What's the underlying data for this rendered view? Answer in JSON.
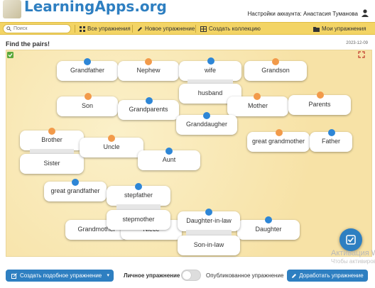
{
  "header": {
    "logo_text": "LearningApps.org",
    "account_text": "Настройки аккаунта: Анастасия Туманова"
  },
  "nav": {
    "search_placeholder": "Поиск",
    "all_exercises": "Все упражнения",
    "new_exercise": "Новое упражнение",
    "create_collection": "Создать коллекцию",
    "my_exercises": "Мои упражнения"
  },
  "exercise": {
    "title": "Find the pairs!",
    "date": "2023-12-09"
  },
  "cards": {
    "grandfather": "Grandfather",
    "nephew": "Nephew",
    "wife": "wife",
    "husband": "husband",
    "grandson": "Grandson",
    "son": "Son",
    "grandparents": "Grandparents",
    "granddaughter": "Granddaugher",
    "mother": "Mother",
    "parents": "Parents",
    "brother": "Brother",
    "sister": "Sister",
    "uncle": "Uncle",
    "aunt": "Aunt",
    "great_grandmother": "great grandmother",
    "father": "Father",
    "great_grandfather": "great grandfather",
    "stepfather": "stepfather",
    "stepmother": "stepmother",
    "grandmother": "Grandmother",
    "niece": "Niece",
    "daughter_in_law": "Daughter-in-law",
    "son_in_law": "Son-in-law",
    "daughter": "Daughter"
  },
  "pin_colors": {
    "blue": "#2e86d6",
    "orange": "#f29a4a"
  },
  "footer": {
    "create_similar": "Создать подобное упражнение",
    "private_label": "Личное упражнение",
    "published_label": "Опубликованное упражнение",
    "finish_button": "Доработать упражнение"
  },
  "watermark": {
    "line1": "Активация W",
    "line2": "Чтобы активиров"
  }
}
